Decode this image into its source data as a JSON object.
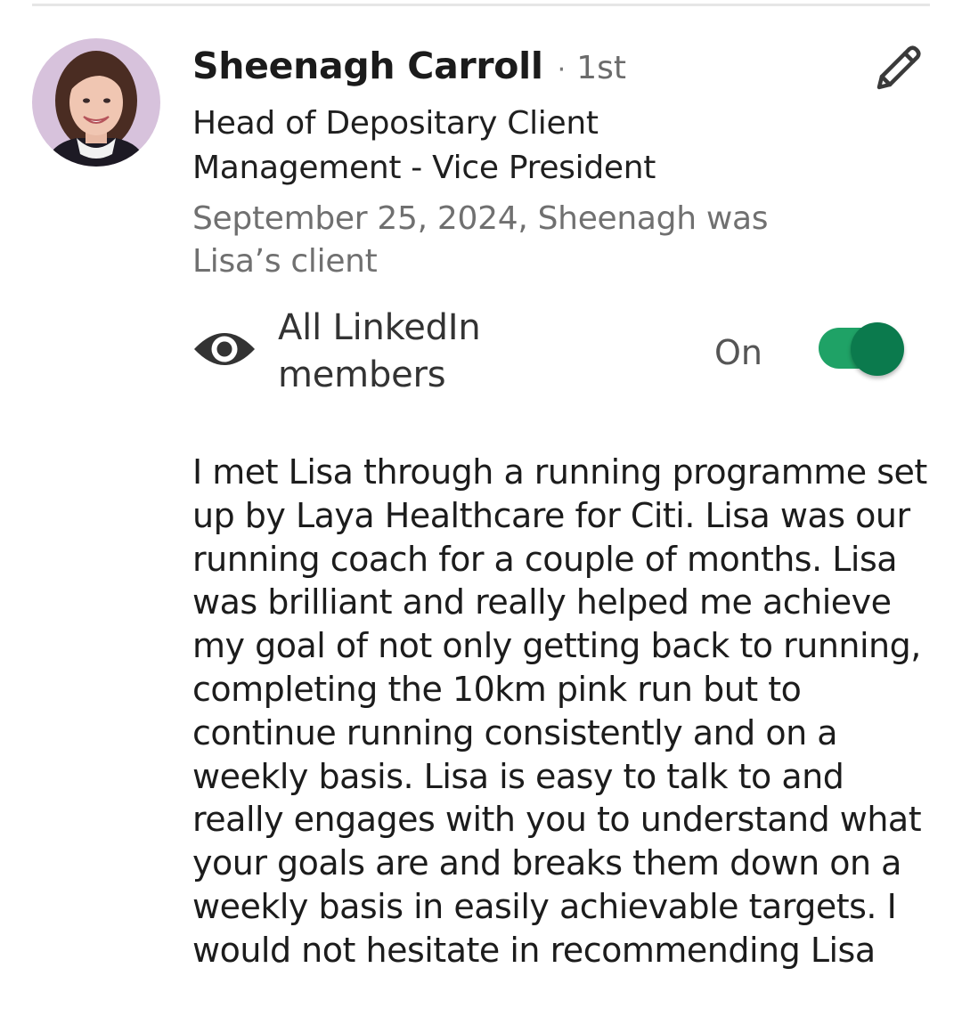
{
  "recommender": {
    "name": "Sheenagh Carroll",
    "separator": "·",
    "degree": "1st",
    "headline": "Head of Depositary Client Management - Vice President",
    "relationship": "September 25, 2024, Sheenagh was Lisa’s client",
    "avatar_icon": "profile-photo"
  },
  "actions": {
    "edit_icon": "pencil-icon"
  },
  "visibility": {
    "icon": "eye-icon",
    "label": "All LinkedIn members",
    "state_label": "On",
    "enabled": true,
    "accent_color": "#0b7a4d"
  },
  "recommendation_text": "I met Lisa through a running programme set up by Laya Healthcare for Citi. Lisa was our running coach for a couple of months. Lisa was brilliant and really helped me achieve my goal of not only getting back to running, completing the 10km pink run but to continue running consistently and on a weekly basis.  Lisa is easy to talk to and really engages with you to understand what your goals are and breaks them down on a weekly basis in easily achievable targets. I would not hesitate in recommending Lisa"
}
